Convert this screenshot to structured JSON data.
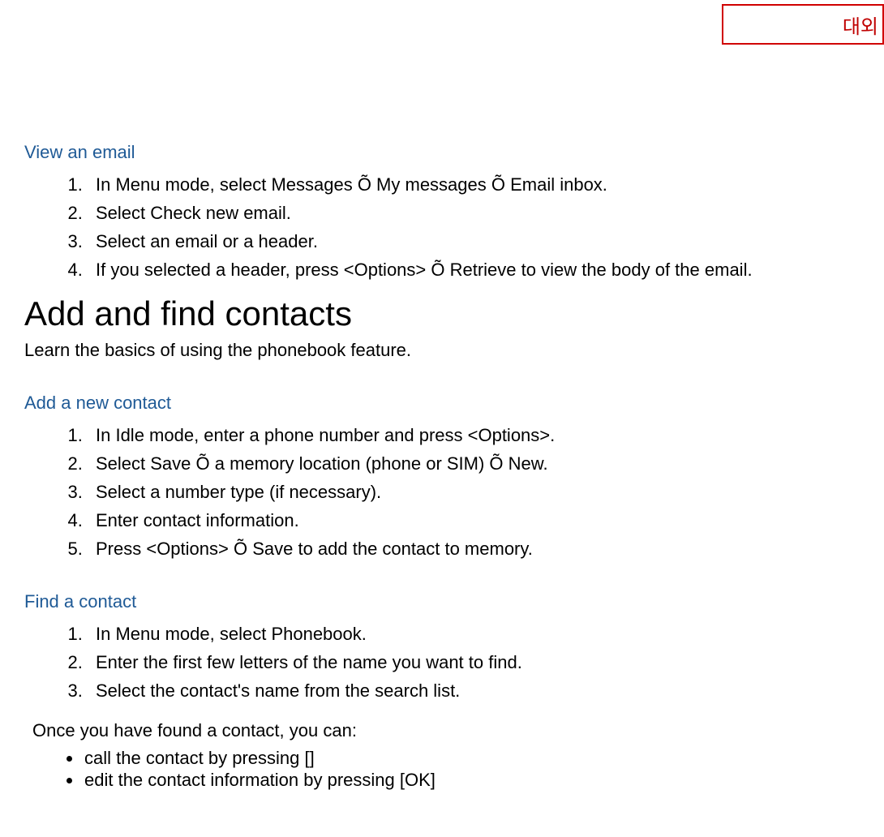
{
  "stamp": "대외",
  "section1": {
    "heading": "View an email",
    "steps": [
      "In Menu mode, select Messages Õ My messages Õ Email inbox.",
      "Select Check new email.",
      "Select an email or a header.",
      "If you selected a header, press <Options> Õ Retrieve to view the body of the email."
    ]
  },
  "main": {
    "heading": "Add and find contacts",
    "intro": "Learn the basics of using the phonebook feature."
  },
  "section2": {
    "heading": "Add a new contact",
    "steps": [
      "In Idle mode, enter a phone number and press <Options>.",
      "Select Save Õ a memory location (phone or SIM) Õ New.",
      "Select a number type (if necessary).",
      "Enter contact information.",
      "Press <Options> Õ Save to add the contact to memory."
    ]
  },
  "section3": {
    "heading": "Find a contact",
    "steps": [
      "In Menu mode, select Phonebook.",
      "Enter the first few letters of the name you want to find.",
      "Select the contact's name from the search list."
    ]
  },
  "after": {
    "intro": "Once you have found a contact, you can:",
    "bullets": [
      "call the contact by pressing []",
      "edit the contact information by pressing [OK]"
    ]
  }
}
